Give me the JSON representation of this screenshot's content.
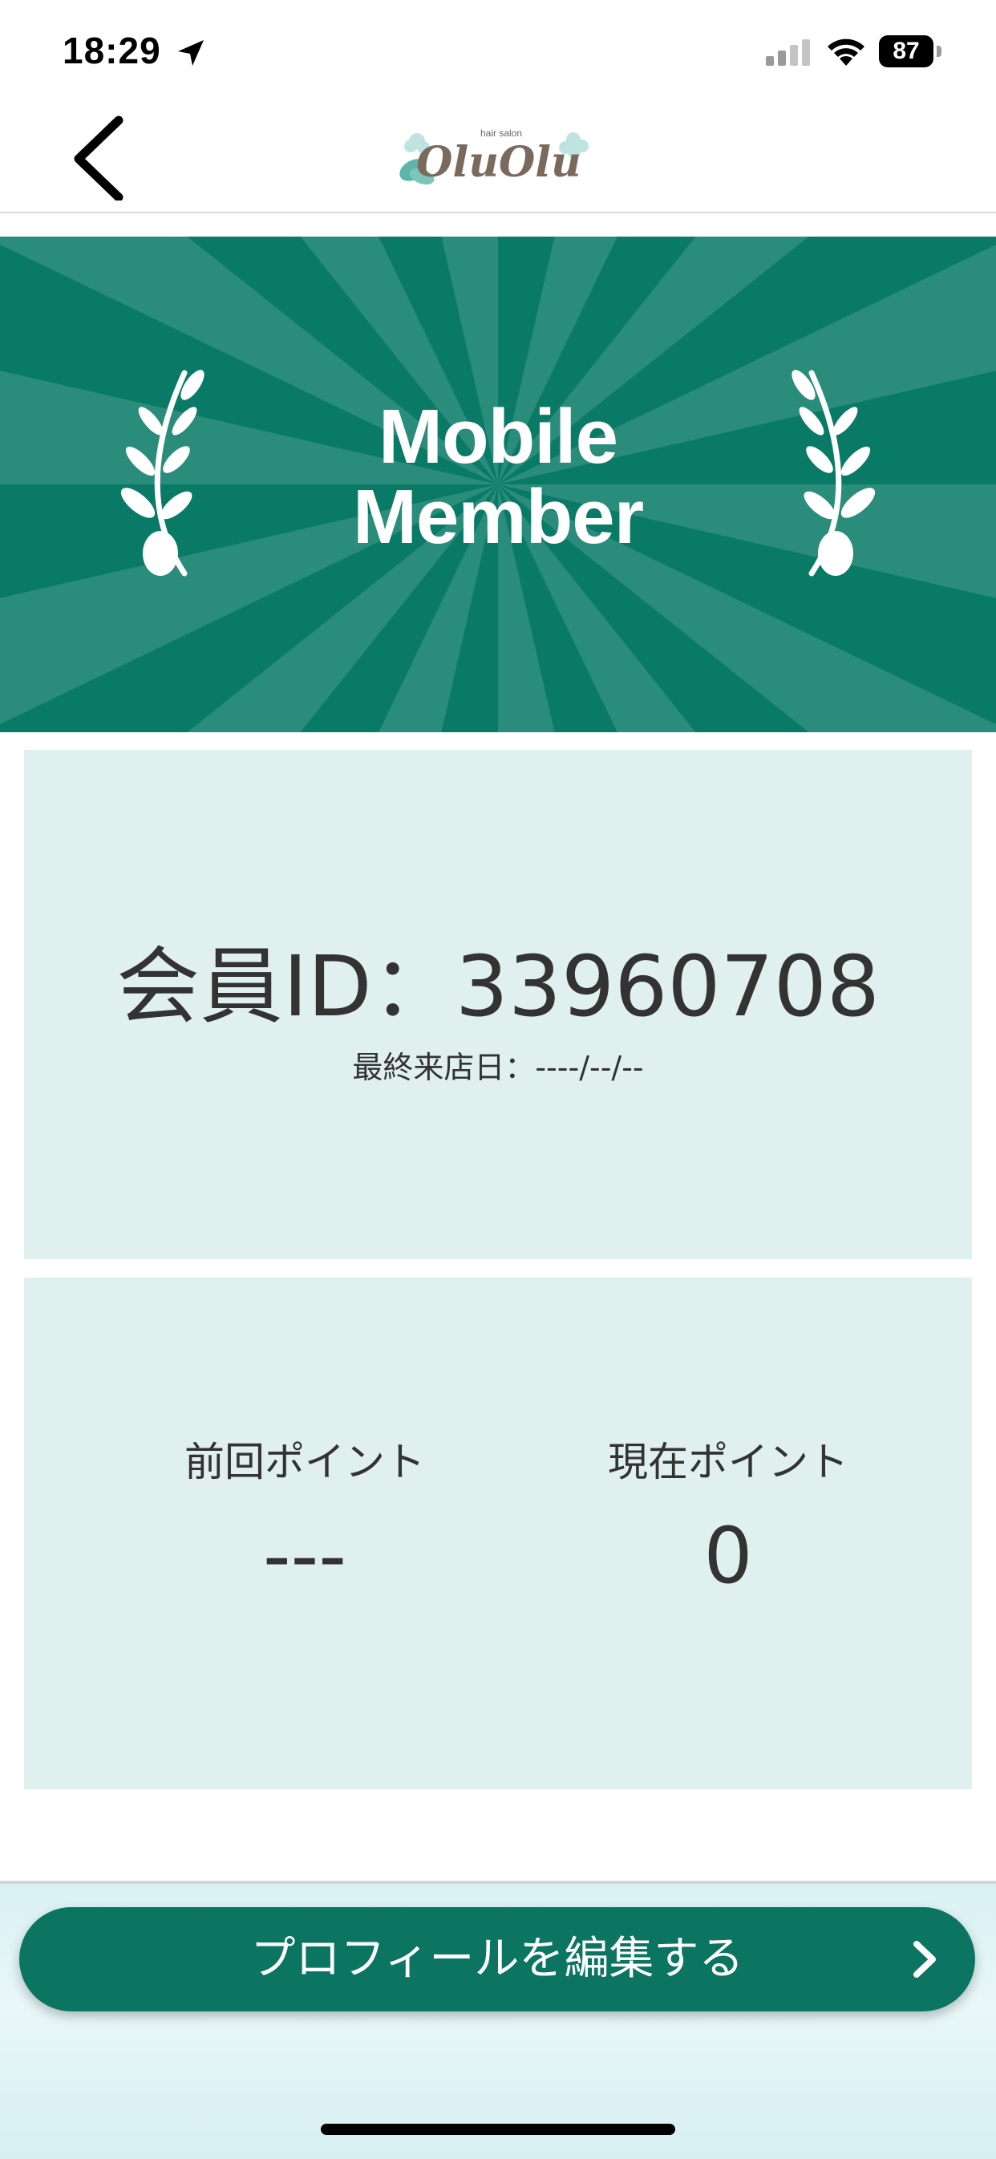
{
  "status_bar": {
    "time": "18:29",
    "battery_level": "87",
    "icons": [
      "location-arrow-icon",
      "cellular-signal-icon",
      "wifi-icon",
      "battery-icon"
    ]
  },
  "navbar": {
    "back_icon": "chevron-left-icon",
    "logo_text": "OluOlu",
    "logo_subtext": "hair salon"
  },
  "banner": {
    "title_line1": "Mobile",
    "title_line2": "Member",
    "decorations": [
      "laurel-branch-icon",
      "laurel-branch-icon"
    ]
  },
  "member_card": {
    "id_text": "会員ID：33960708",
    "last_visit": "最終来店日：----/--/--"
  },
  "points_card": {
    "previous_label": "前回ポイント",
    "previous_value": "---",
    "current_label": "現在ポイント",
    "current_value": "0"
  },
  "edit_profile_button": {
    "label": "プロフィールを編集する",
    "icon": "chevron-right-icon"
  },
  "colors": {
    "primary": "#097a66",
    "card_bg": "#dff0ee",
    "text": "#333333"
  }
}
